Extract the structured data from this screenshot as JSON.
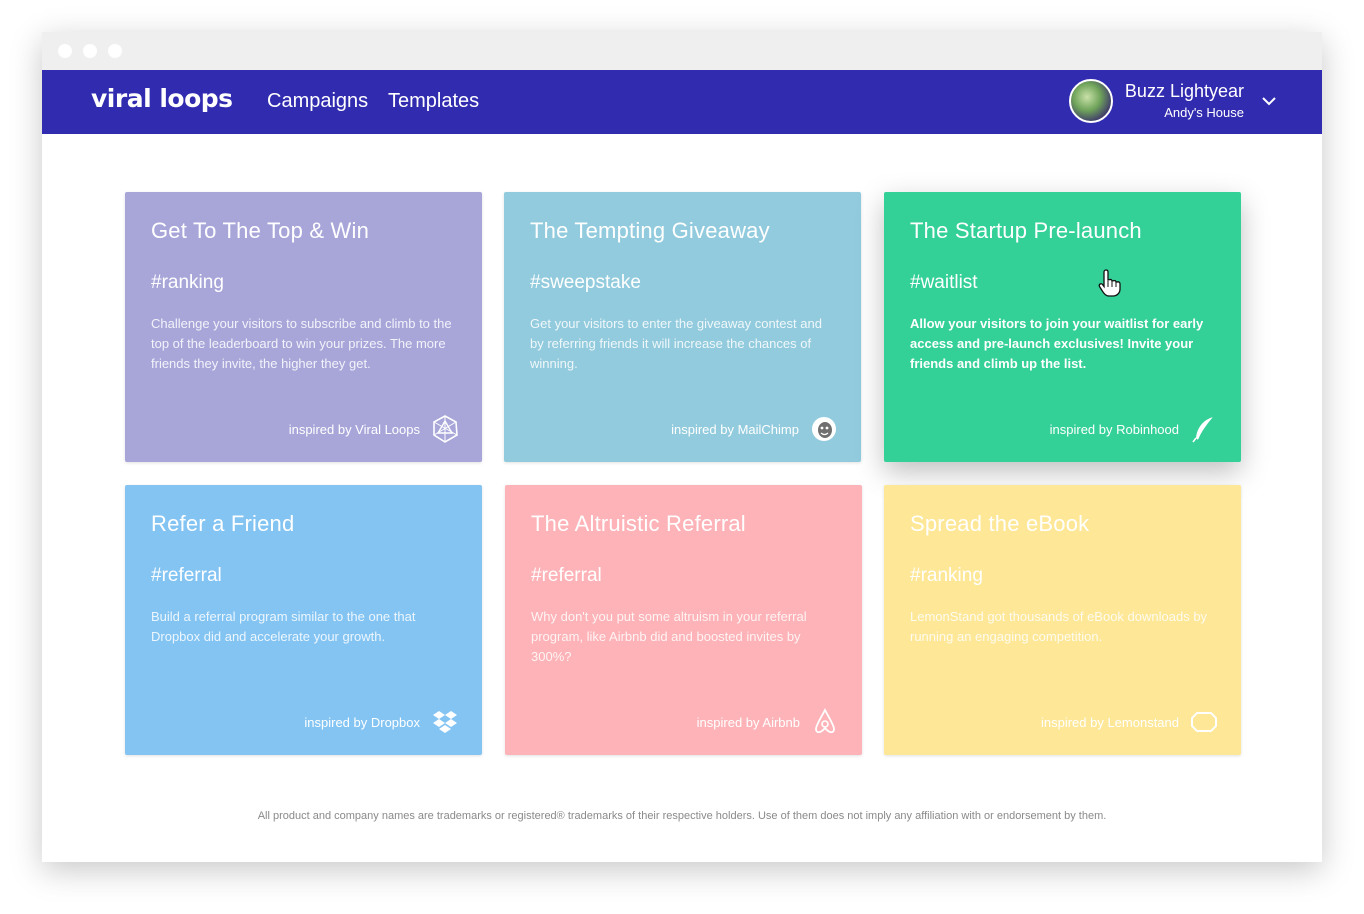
{
  "nav": {
    "logo": "viral loops",
    "links": [
      "Campaigns",
      "Templates"
    ],
    "user": {
      "name": "Buzz Lightyear",
      "org": "Andy's House"
    }
  },
  "cards": [
    {
      "title": "Get To The Top & Win",
      "tag": "#ranking",
      "description": "Challenge your visitors to subscribe and climb to the top of the leaderboard to win your prizes. The more friends they invite, the higher they get.",
      "inspired": "inspired by Viral Loops",
      "icon": "viral-loops-icon",
      "color": "#a8a6d9"
    },
    {
      "title": "The Tempting Giveaway",
      "tag": "#sweepstake",
      "description": "Get your visitors to enter the giveaway contest and by referring friends it will increase the chances of winning.",
      "inspired": "inspired by MailChimp",
      "icon": "mailchimp-icon",
      "color": "#92cbdd"
    },
    {
      "title": "The Startup Pre-launch",
      "tag": "#waitlist",
      "description": "Allow your visitors to join your waitlist for early access and pre-launch exclusives! Invite your friends and climb up the list.",
      "inspired": "inspired by Robinhood",
      "icon": "robinhood-feather-icon",
      "color": "#33d098"
    },
    {
      "title": "Refer a Friend",
      "tag": "#referral",
      "description": "Build a referral program similar to the one that Dropbox did and accelerate your growth.",
      "inspired": "inspired by Dropbox",
      "icon": "dropbox-icon",
      "color": "#83c4f3"
    },
    {
      "title": "The Altruistic Referral",
      "tag": "#referral",
      "description": "Why don't you put some altruism in your referral program, like Airbnb did and boosted invites by 300%?",
      "inspired": "inspired by Airbnb",
      "icon": "airbnb-icon",
      "color": "#fdb3b7"
    },
    {
      "title": "Spread the eBook",
      "tag": "#ranking",
      "description": "LemonStand got thousands of eBook downloads by running an engaging competition.",
      "inspired": "inspired by Lemonstand",
      "icon": "lemonstand-icon",
      "color": "#fee796"
    }
  ],
  "disclaimer": "All product and company names are trademarks or registered® trademarks of their respective holders. Use of them does not imply any affiliation with or endorsement by them."
}
